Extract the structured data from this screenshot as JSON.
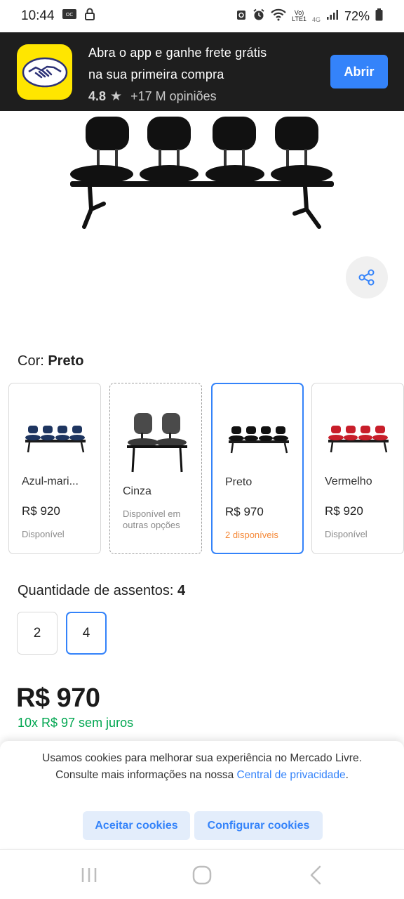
{
  "status_bar": {
    "time": "10:44",
    "battery": "72%",
    "network_top": "Vo)",
    "network_bottom": "LTE1",
    "network_type": "4G",
    "icons": [
      "nfc-icon",
      "lock-icon",
      "sync-icon",
      "alarm-icon",
      "wifi-icon",
      "signal-icon",
      "battery-icon"
    ]
  },
  "app_banner": {
    "line1": "Abra o app e ganhe frete grátis",
    "line2": "na sua primeira compra",
    "rating": "4.8",
    "reviews": "+17 M opiniões",
    "open_button": "Abrir",
    "logo_color": "#ffe600"
  },
  "color_picker": {
    "label": "Cor: ",
    "selected": "Preto",
    "variants": [
      {
        "name": "Azul-mari...",
        "price": "R$ 920",
        "status": "Disponível",
        "chair_color": "#1e3560"
      },
      {
        "name": "Cinza",
        "status": "Disponível em outras opções",
        "chair_color": "#4a4a4a"
      },
      {
        "name": "Preto",
        "price": "R$ 970",
        "status": "2 disponíveis",
        "chair_color": "#111111"
      },
      {
        "name": "Vermelho",
        "price": "R$ 920",
        "status": "Disponível",
        "chair_color": "#c81e2a"
      }
    ]
  },
  "quantity": {
    "label": "Quantidade de assentos: ",
    "selected": "4",
    "options": [
      "2",
      "4"
    ]
  },
  "price": {
    "main": "R$ 970",
    "installments": "10x R$ 97 sem juros"
  },
  "cookie_banner": {
    "text_before": "Usamos cookies para melhorar sua experiência no Mercado Livre. Consulte mais informações na nossa ",
    "link": "Central de privacidade",
    "text_after": ".",
    "accept_button": "Aceitar cookies",
    "configure_button": "Configurar cookies"
  },
  "colors": {
    "accent": "#3483fa",
    "success": "#00a650",
    "warning": "#f58a3a"
  }
}
